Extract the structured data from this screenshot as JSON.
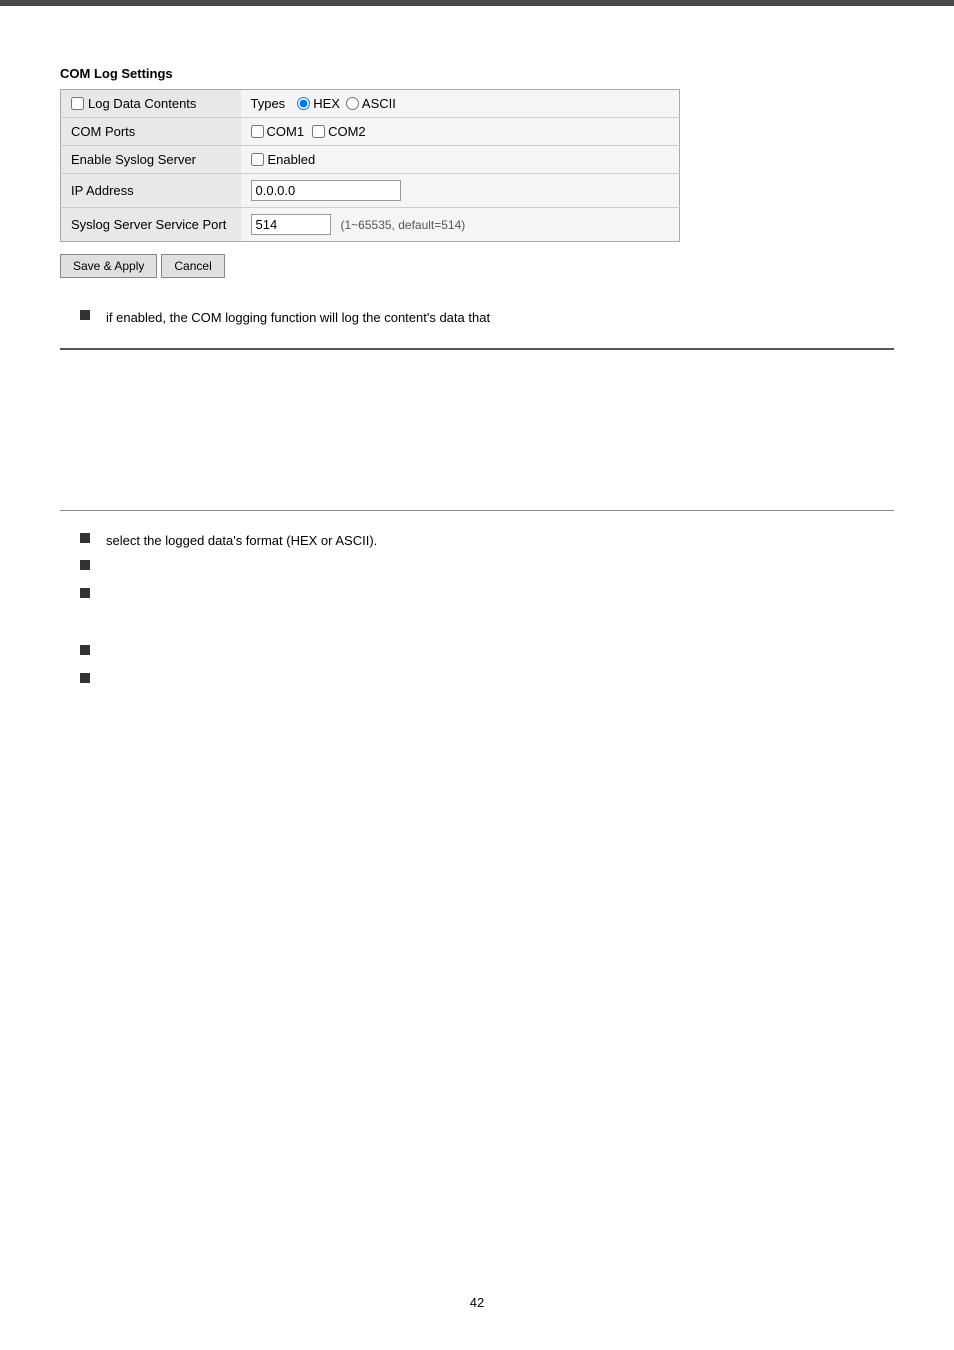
{
  "top_bar": {},
  "section": {
    "title": "COM Log Settings"
  },
  "table": {
    "rows": [
      {
        "label": "Log Data Contents",
        "field_type": "radio",
        "types_label": "Types",
        "options": [
          "HEX",
          "ASCII"
        ],
        "selected": "HEX"
      },
      {
        "label": "COM Ports",
        "field_type": "checkbox_ports",
        "ports": [
          "COM1",
          "COM2"
        ]
      },
      {
        "label": "Enable Syslog Server",
        "field_type": "checkbox_single",
        "option_label": "Enabled"
      },
      {
        "label": "IP Address",
        "field_type": "text",
        "value": "0.0.0.0"
      },
      {
        "label": "Syslog Server Service Port",
        "field_type": "text_hint",
        "value": "514",
        "hint": "(1~65535, default=514)"
      }
    ]
  },
  "buttons": {
    "save_apply": "Save & Apply",
    "cancel": "Cancel"
  },
  "bullets": [
    {
      "id": 1,
      "text": "if enabled, the COM logging function will log the content's data that"
    }
  ],
  "bullets2": [
    {
      "id": 1,
      "text": "select the logged data's format (HEX or ASCII)."
    },
    {
      "id": 2,
      "text": ""
    },
    {
      "id": 3,
      "text": ""
    },
    {
      "id": 4,
      "text": ""
    },
    {
      "id": 5,
      "text": ""
    }
  ],
  "page_number": "42"
}
